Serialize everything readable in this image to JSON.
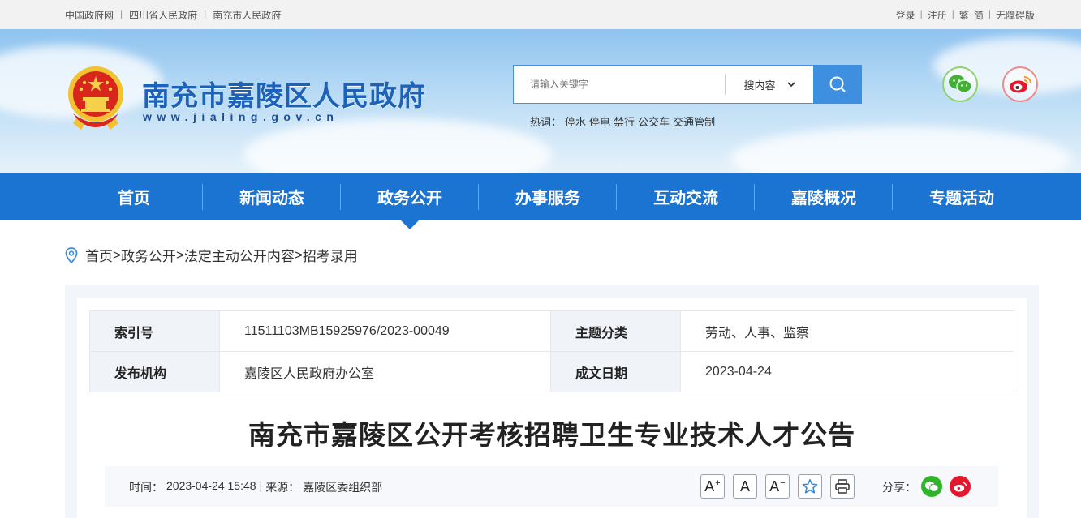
{
  "topbar": {
    "links_left": [
      "中国政府网",
      "四川省人民政府",
      "南充市人民政府"
    ],
    "login": "登录",
    "register": "注册",
    "trad": "繁",
    "simp": "简",
    "accessibility": "无障碍版"
  },
  "header": {
    "title": "南充市嘉陵区人民政府",
    "url": "www.jialing.gov.cn",
    "search_placeholder": "请输入关键字",
    "search_scope": "搜内容",
    "hot_label": "热词：",
    "hot_words": [
      "停水",
      "停电",
      "禁行",
      "公交车",
      "交通管制"
    ]
  },
  "nav": {
    "items": [
      "首页",
      "新闻动态",
      "政务公开",
      "办事服务",
      "互动交流",
      "嘉陵概况",
      "专题活动"
    ],
    "active": "政务公开"
  },
  "breadcrumb": {
    "items": [
      "首页",
      "政务公开",
      "法定主动公开内容",
      "招考录用"
    ],
    "separator": ">"
  },
  "meta_table": {
    "index_label": "索引号",
    "index_value": "11511103MB15925976/2023-00049",
    "topic_label": "主题分类",
    "topic_value": "劳动、人事、监察",
    "publisher_label": "发布机构",
    "publisher_value": "嘉陵区人民政府办公室",
    "date_label": "成文日期",
    "date_value": "2023-04-24"
  },
  "article": {
    "title": "南充市嘉陵区公开考核招聘卫生专业技术人才公告",
    "time_label": "时间：",
    "time_value": "2023-04-24 15:48",
    "source_label": "来源：",
    "source_value": "嘉陵区委组织部",
    "share_label": "分享："
  },
  "colors": {
    "nav_blue": "#1b74d1",
    "title_blue": "#1c62b9",
    "wechat_green": "#2fb52b",
    "weibo_red": "#e6162d"
  }
}
